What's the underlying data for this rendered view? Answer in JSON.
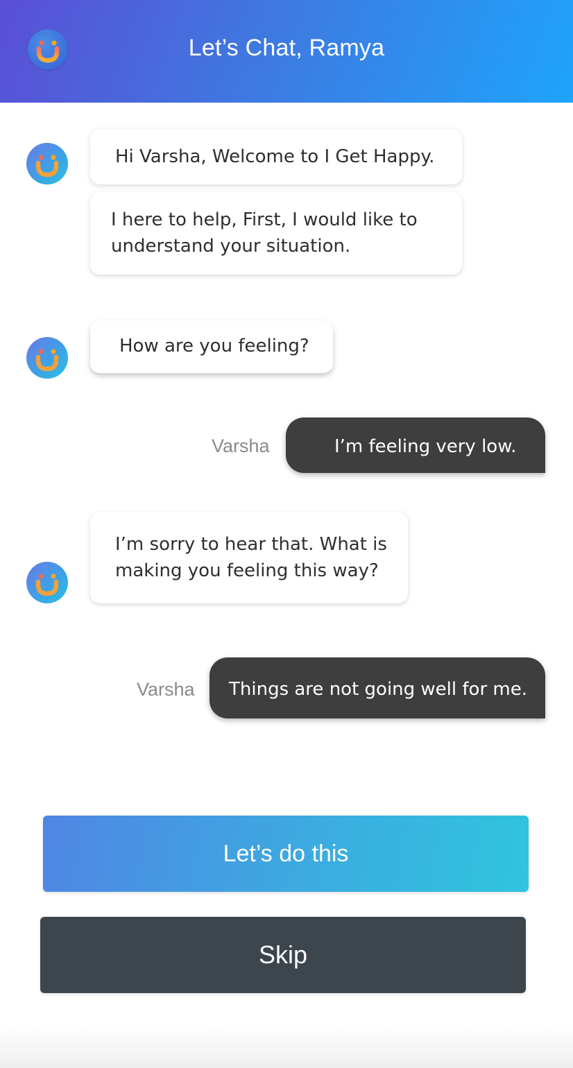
{
  "header": {
    "title": "Let’s Chat, Ramya",
    "logo_icon": "smiley-logo-icon",
    "gradient_start": "#5a4fd6",
    "gradient_end": "#1ea4fb"
  },
  "messages": [
    {
      "from": "bot",
      "text": "Hi Varsha, Welcome to I Get Happy."
    },
    {
      "from": "bot",
      "text": "I here to help, First, I would like to understand your situation."
    },
    {
      "from": "bot",
      "text": "How are you feeling?"
    },
    {
      "from": "user",
      "sender": "Varsha",
      "text": "I’m feeling very low."
    },
    {
      "from": "bot",
      "text": "I’m sorry to hear that. What is making you feeling this way?"
    },
    {
      "from": "user",
      "sender": "Varsha",
      "text": "Things are not going well for me."
    }
  ],
  "actions": {
    "primary_label": "Let’s do this",
    "secondary_label": "Skip",
    "primary_color": "#3cabe0",
    "secondary_color": "#3d454d"
  },
  "colors": {
    "user_bubble": "#3e3e3e",
    "bot_bubble": "#ffffff",
    "avatar_accent_orange": "#f5a623",
    "avatar_accent_red": "#f06a5a"
  }
}
